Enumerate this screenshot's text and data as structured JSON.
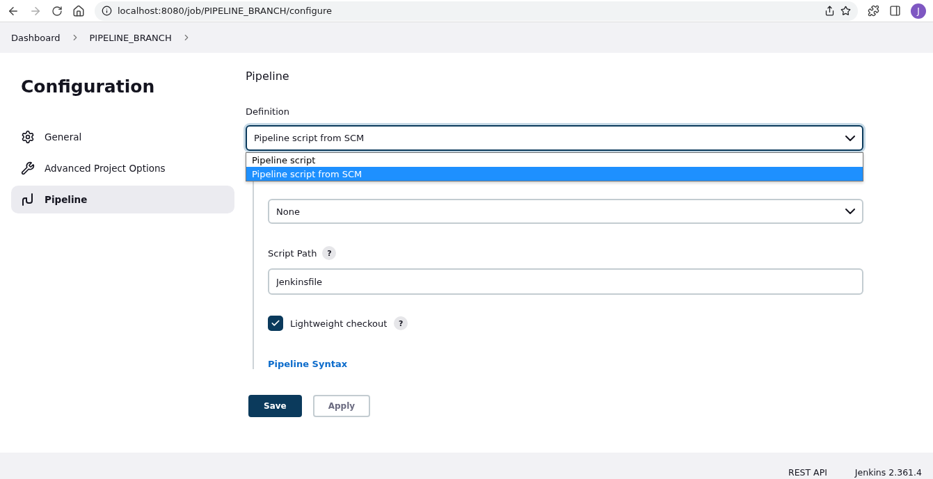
{
  "browser": {
    "url": "localhost:8080/job/PIPELINE_BRANCH/configure",
    "avatar": "J"
  },
  "breadcrumbs": [
    "Dashboard",
    "PIPELINE_BRANCH"
  ],
  "sidebar": {
    "title": "Configuration",
    "items": [
      {
        "label": "General",
        "kind": "gear",
        "selected": false
      },
      {
        "label": "Advanced Project Options",
        "kind": "wrench",
        "selected": false
      },
      {
        "label": "Pipeline",
        "kind": "pipeline",
        "selected": true
      }
    ]
  },
  "section": {
    "title": "Pipeline",
    "definition": {
      "label": "Definition",
      "value": "Pipeline script from SCM",
      "expanded": true,
      "options": [
        {
          "label": "Pipeline script",
          "selected": false
        },
        {
          "label": "Pipeline script from SCM",
          "selected": true
        }
      ]
    },
    "scm": {
      "value": "None"
    },
    "script_path": {
      "label": "Script Path",
      "help": "?",
      "value": "Jenkinsfile"
    },
    "lightweight_checkout": {
      "label": "Lightweight checkout",
      "help": "?",
      "checked": true
    },
    "link": "Pipeline Syntax"
  },
  "buttons": [
    {
      "label": "Save",
      "kind": "primary"
    },
    {
      "label": "Apply",
      "kind": "secondary"
    }
  ],
  "footer": [
    "REST API",
    "Jenkins 2.361.4"
  ]
}
